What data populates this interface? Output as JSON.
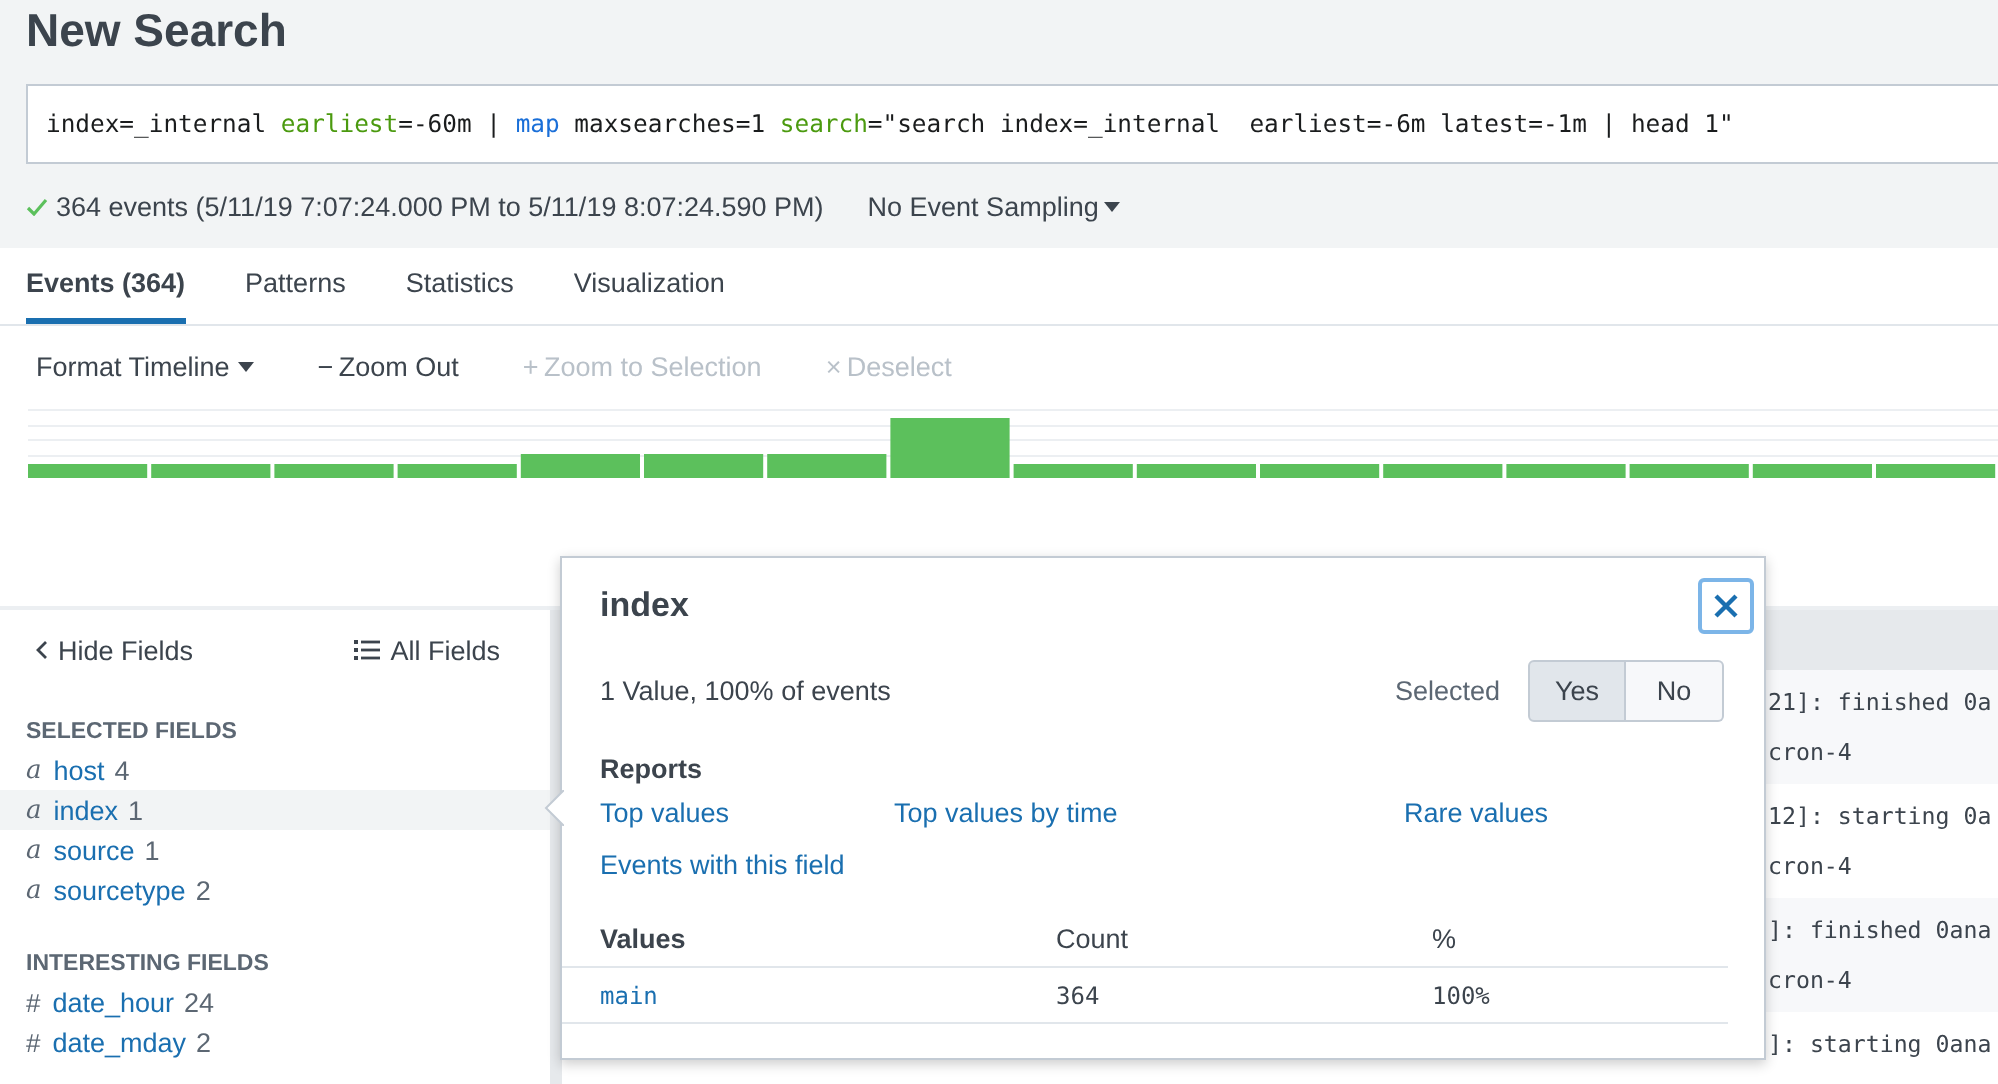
{
  "title": "New Search",
  "search": {
    "tokens": [
      {
        "text": "index=_internal ",
        "kind": "plain"
      },
      {
        "text": "earliest",
        "kind": "argument"
      },
      {
        "text": "=-60m | ",
        "kind": "plain"
      },
      {
        "text": "map",
        "kind": "command"
      },
      {
        "text": " maxsearches=1 ",
        "kind": "plain"
      },
      {
        "text": "search",
        "kind": "argument"
      },
      {
        "text": "=\"search index=_internal  earliest=-6m latest=-1m | head 1\"",
        "kind": "plain"
      }
    ]
  },
  "status": {
    "summary": "364 events (5/11/19 7:07:24.000 PM to 5/11/19 8:07:24.590 PM)",
    "sampling": "No Event Sampling"
  },
  "tabs": [
    {
      "label": "Events (364)",
      "selected": true
    },
    {
      "label": "Patterns",
      "selected": false
    },
    {
      "label": "Statistics",
      "selected": false
    },
    {
      "label": "Visualization",
      "selected": false
    }
  ],
  "toolbar": [
    {
      "kind": "menu",
      "label": "Format Timeline",
      "disabled": false
    },
    {
      "kind": "button",
      "icon": "−",
      "label": "Zoom Out",
      "disabled": false
    },
    {
      "kind": "button",
      "icon": "+",
      "label": "Zoom to Selection",
      "disabled": true
    },
    {
      "kind": "button",
      "icon": "×",
      "label": "Deselect",
      "disabled": true
    }
  ],
  "sidebar": {
    "hide": "Hide Fields",
    "all": "All Fields",
    "groups": [
      {
        "heading": "SELECTED FIELDS",
        "fields": [
          {
            "glyph": "a",
            "kind": "string",
            "name": "host",
            "count": "4",
            "selected": false
          },
          {
            "glyph": "a",
            "kind": "string",
            "name": "index",
            "count": "1",
            "selected": true
          },
          {
            "glyph": "a",
            "kind": "string",
            "name": "source",
            "count": "1",
            "selected": false
          },
          {
            "glyph": "a",
            "kind": "string",
            "name": "sourcetype",
            "count": "2",
            "selected": false
          }
        ]
      },
      {
        "heading": "INTERESTING FIELDS",
        "fields": [
          {
            "glyph": "#",
            "kind": "number",
            "name": "date_hour",
            "count": "24",
            "selected": false
          },
          {
            "glyph": "#",
            "kind": "number",
            "name": "date_mday",
            "count": "2",
            "selected": false
          }
        ]
      }
    ]
  },
  "events": [
    {
      "lines": [
        "21]: finished 0a",
        "cron-4"
      ]
    },
    {
      "lines": [
        "12]: starting 0a",
        "cron-4"
      ]
    },
    {
      "lines": [
        "]: finished 0ana",
        "cron-4"
      ]
    },
    {
      "lines": [
        "]: starting 0ana"
      ]
    }
  ],
  "popup": {
    "title": "index",
    "summary": "1 Value, 100% of events",
    "selected_label": "Selected",
    "toggle": [
      {
        "label": "Yes",
        "selected": true
      },
      {
        "label": "No",
        "selected": false
      }
    ],
    "reports_heading": "Reports",
    "reports": [
      "Top values",
      "Top values by time",
      "Rare values",
      "Events with this field"
    ],
    "columns": [
      "Values",
      "Count",
      "%"
    ],
    "rows": [
      [
        "main",
        "364",
        "100%"
      ]
    ]
  }
}
